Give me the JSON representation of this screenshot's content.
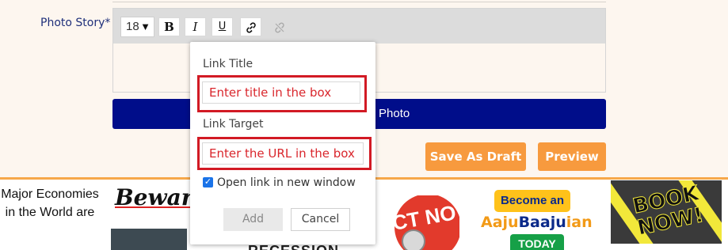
{
  "form": {
    "photo_story_label": "Photo Story*",
    "font_size": "18",
    "toolbar": {
      "bold": "B",
      "italic": "I",
      "underline": "U"
    },
    "upload_label": "Photo",
    "save_draft_label": "Save As Draft",
    "preview_label": "Preview"
  },
  "link_popup": {
    "title_label": "Link Title",
    "title_placeholder": "Enter title in the box",
    "target_label": "Link Target",
    "target_placeholder": "Enter the URL in the box",
    "new_window_label": "Open link in new window",
    "new_window_checked": true,
    "add_label": "Add",
    "cancel_label": "Cancel"
  },
  "ads": {
    "text_ad": "Major Economies in the World are",
    "beware": "Beware",
    "recession": "RECESSION",
    "act": "ACT NOW",
    "become": "Become an",
    "aaju_1": "Aaju",
    "aaju_2": "Baaju",
    "aaju_3": "ian",
    "today": "TODAY",
    "book_now": "BOOK NOW!"
  },
  "colors": {
    "accent_orange": "#f79a3e",
    "upload_blue": "#000d8a",
    "highlight_red": "#d21a24",
    "background": "#fdf6ef"
  }
}
